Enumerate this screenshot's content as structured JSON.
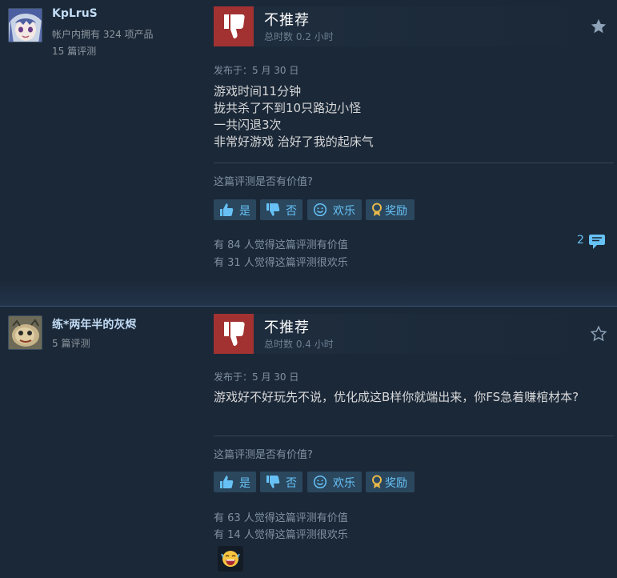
{
  "reviews": [
    {
      "username": "KpLruS",
      "owned": "帐户内拥有 324 项产品",
      "reviews_count": "15 篇评测",
      "verdict": "不推荐",
      "hours": "总时数 0.2 小时",
      "posted": "发布于：5 月 30 日",
      "body_lines": [
        "游戏时间11分钟",
        "拢共杀了不到10只路边小怪",
        "一共闪退3次",
        "非常好游戏 治好了我的起床气"
      ],
      "helpful_question": "这篇评测是否有价值?",
      "buttons": {
        "yes": "是",
        "no": "否",
        "funny": "欢乐",
        "award": "奖励"
      },
      "helpful_stat": "有 84 人觉得这篇评测有价值",
      "funny_stat": "有 31 人觉得这篇评测很欢乐",
      "comment_count": "2",
      "star_color": "#8fa3b8"
    },
    {
      "username": "练*两年半的灰烬",
      "reviews_count": "5 篇评测",
      "verdict": "不推荐",
      "hours": "总时数 0.4 小时",
      "posted": "发布于：5 月 30 日",
      "body_lines": [
        "游戏好不好玩先不说，优化成这B样你就端出来，你FS急着赚棺材本?"
      ],
      "helpful_question": "这篇评测是否有价值?",
      "buttons": {
        "yes": "是",
        "no": "否",
        "funny": "欢乐",
        "award": "奖励"
      },
      "helpful_stat": "有 63 人觉得这篇评测有价值",
      "funny_stat": "有 14 人觉得这篇评测很欢乐",
      "award_icon": "laughing-face-award-icon"
    }
  ],
  "colors": {
    "background": "#1b2838",
    "thumb_down_bg": "#a23232",
    "button_bg": "#2a475e",
    "link_blue": "#67c1f5",
    "username": "#c1dbf4"
  }
}
